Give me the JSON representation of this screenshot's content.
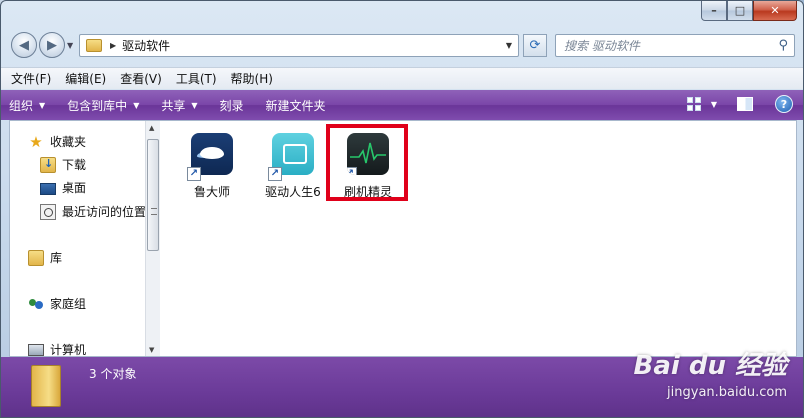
{
  "window": {
    "min_glyph": "–",
    "max_glyph": "□",
    "close_glyph": "✕"
  },
  "navigation": {
    "back_glyph": "◀",
    "forward_glyph": "▶",
    "address_path": "驱动软件",
    "search_placeholder": "搜索 驱动软件"
  },
  "menu": [
    "文件(F)",
    "编辑(E)",
    "查看(V)",
    "工具(T)",
    "帮助(H)"
  ],
  "commands": {
    "organize": "组织",
    "include_in_library": "包含到库中",
    "share": "共享",
    "burn": "刻录",
    "new_folder": "新建文件夹",
    "help": "?"
  },
  "sidebar": {
    "favorites": "收藏夹",
    "downloads": "下载",
    "desktop": "桌面",
    "recent_places": "最近访问的位置",
    "libraries": "库",
    "homegroup": "家庭组",
    "computer": "计算机"
  },
  "files": [
    {
      "name": "鲁大师",
      "icon": "ludashi-icon",
      "shortcut": true
    },
    {
      "name": "驱动人生6",
      "icon": "qudongrensheng-icon",
      "shortcut": true
    },
    {
      "name": "刷机精灵",
      "icon": "shuajijingling-icon",
      "shortcut": true,
      "highlighted": true
    }
  ],
  "status": {
    "item_count": "3 个对象"
  },
  "watermark": {
    "brand": "Bai du 经验",
    "url": "jingyan.baidu.com"
  },
  "colors": {
    "command_bar": "#7a45a8",
    "highlight": "#e0001a",
    "details_pane": "#6a3a98"
  }
}
